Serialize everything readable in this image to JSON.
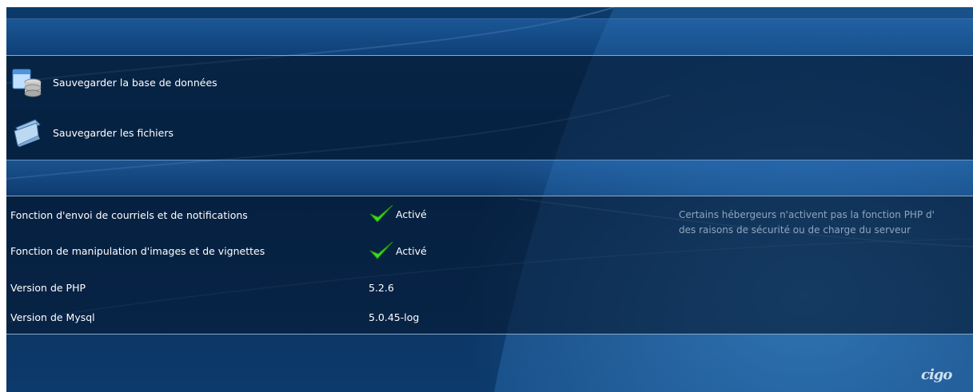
{
  "actions": {
    "backup_db": "Sauvegarder la base de données",
    "backup_files": "Sauvegarder les fichiers"
  },
  "info": {
    "mail_label": "Fonction d'envoi de courriels et de notifications",
    "mail_status": "Activé",
    "image_label": "Fonction de manipulation d'images et de vignettes",
    "image_status": "Activé",
    "php_label": "Version de PHP",
    "php_value": "5.2.6",
    "mysql_label": "Version de Mysql",
    "mysql_value": "5.0.45-log",
    "note_line1": "Certains hébergeurs n'activent pas la fonction PHP d'",
    "note_line2": "des raisons de sécurité ou de charge du serveur"
  },
  "logo_text": "cigo",
  "colors": {
    "check": "#3fdc1e",
    "note": "#8fa6bd",
    "border": "#8aa9c6"
  }
}
